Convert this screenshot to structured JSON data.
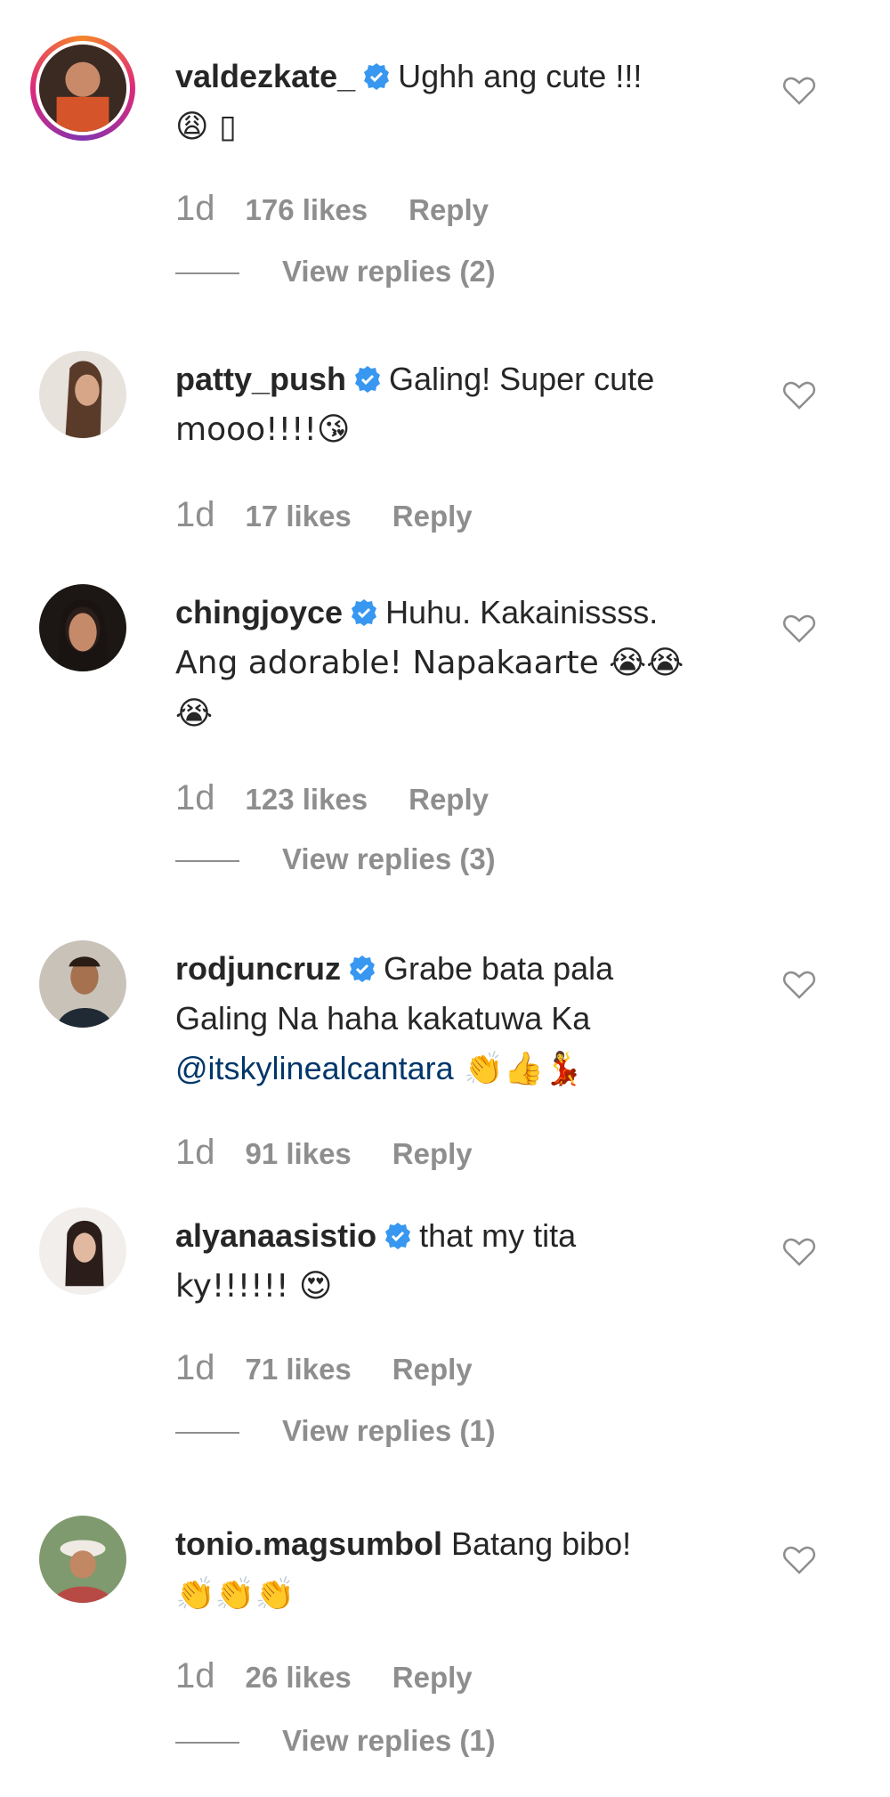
{
  "comments": [
    {
      "username": "valdezkate_",
      "text": "Ughh ang cute !!!",
      "line2": "😩 ▯",
      "time": "1d",
      "likes": "176 likes",
      "reply": "Reply",
      "view_replies": "View replies (2)"
    },
    {
      "username": "patty_push",
      "text": "Galing! Super cute",
      "line2": "mooo!!!!😘",
      "time": "1d",
      "likes": "17 likes",
      "reply": "Reply"
    },
    {
      "username": "chingjoyce",
      "text": "Huhu. Kakainissss.",
      "line2": "Ang adorable! Napakaarte 😭😭",
      "line3": "😭",
      "time": "1d",
      "likes": "123 likes",
      "reply": "Reply",
      "view_replies": "View replies (3)"
    },
    {
      "username": "rodjuncruz",
      "text": "Grabe bata pala",
      "line2": "Galing Na haha kakatuwa Ka",
      "mention": "@itskylinealcantara",
      "line3_emoji": " 👏👍💃",
      "time": "1d",
      "likes": "91 likes",
      "reply": "Reply"
    },
    {
      "username": "alyanaasistio",
      "text": "that my tita",
      "line2": "ky!!!!!! 😍",
      "time": "1d",
      "likes": "71 likes",
      "reply": "Reply",
      "view_replies": "View replies (1)"
    },
    {
      "username": "tonio.magsumbol",
      "text": "Batang bibo!",
      "line2": "👏👏👏",
      "time": "1d",
      "likes": "26 likes",
      "reply": "Reply",
      "view_replies": "View replies (1)"
    }
  ],
  "colors": {
    "text": "#262626",
    "muted": "#8e8e8e",
    "verified": "#3897f0",
    "mention": "#00376b"
  }
}
